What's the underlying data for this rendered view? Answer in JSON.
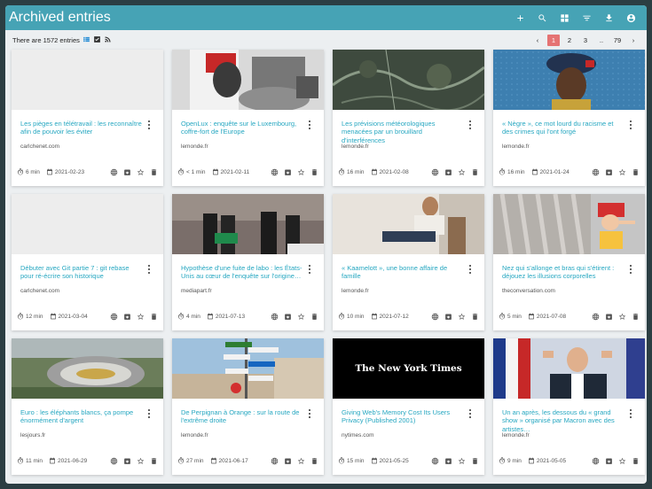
{
  "topbar": {
    "title": "Archived entries",
    "icons": [
      "plus-icon",
      "search-icon",
      "grid-icon",
      "filter-icon",
      "download-icon",
      "account-icon"
    ]
  },
  "subbar": {
    "count_text": "There are 1572 entries",
    "pagination": [
      "‹",
      "1",
      "2",
      "3",
      "..",
      "79",
      "›"
    ],
    "active_page": "1"
  },
  "entries": [
    {
      "title": "Les pièges en télétravail : les reconnaître afin de pouvoir les éviter",
      "domain": "carlchenet.com",
      "reading_time": "6 min",
      "date": "2021-02-23",
      "thumb": "blank"
    },
    {
      "title": "OpenLux : enquête sur le Luxembourg, coffre-fort de l'Europe",
      "domain": "lemonde.fr",
      "reading_time": "< 1 min",
      "date": "2021-02-11",
      "thumb": "collage"
    },
    {
      "title": "Les prévisions météorologiques menacées par un brouillard d'interférences",
      "domain": "lemonde.fr",
      "reading_time": "16 min",
      "date": "2021-02-08",
      "thumb": "satellite"
    },
    {
      "title": "« Nègre », ce mot lourd du racisme et des crimes qui l'ont forgé",
      "domain": "lemonde.fr",
      "reading_time": "16 min",
      "date": "2021-01-24",
      "thumb": "portrait"
    },
    {
      "title": "Débuter avec Git partie 7 : git rebase pour ré-écrire son historique",
      "domain": "carlchenet.com",
      "reading_time": "12 min",
      "date": "2021-03-04",
      "thumb": "blank"
    },
    {
      "title": "Hypothèse d'une fuite de labo : les États-Unis au cœur de l'enquête sur l'origine…",
      "domain": "mediapart.fr",
      "reading_time": "4 min",
      "date": "2021-07-13",
      "thumb": "police"
    },
    {
      "title": "« Kaamelott », une bonne affaire de famille",
      "domain": "lemonde.fr",
      "reading_time": "10 min",
      "date": "2021-07-12",
      "thumb": "man-seated"
    },
    {
      "title": "Nez qui s'allonge et bras qui s'étirent : déjouez les illusions corporelles",
      "domain": "theconversation.com",
      "reading_time": "5 min",
      "date": "2021-07-08",
      "thumb": "pinocchio"
    },
    {
      "title": "Euro : les éléphants blancs, ça pompe énormément d'argent",
      "domain": "lesjours.fr",
      "reading_time": "11 min",
      "date": "2021-06-29",
      "thumb": "stadium"
    },
    {
      "title": "De Perpignan à Orange : sur la route de l'extrême droite",
      "domain": "lemonde.fr",
      "reading_time": "27 min",
      "date": "2021-06-17",
      "thumb": "signposts"
    },
    {
      "title": "Giving Web's Memory Cost Its Users Privacy (Published 2001)",
      "domain": "nytimes.com",
      "reading_time": "15 min",
      "date": "2021-05-25",
      "thumb": "nyt",
      "thumb_text": "The New York Times"
    },
    {
      "title": "Un an après, les dessous du « grand show » organisé par Macron avec des artistes…",
      "domain": "lemonde.fr",
      "reading_time": "9 min",
      "date": "2021-05-05",
      "thumb": "speaker"
    }
  ],
  "card_actions": [
    "globe-icon",
    "archive-icon",
    "star-icon",
    "trash-icon"
  ],
  "colors": {
    "topbar": "#46a3b5",
    "link": "#26a7c1",
    "active_page": "#e57373",
    "background": "#2b3e43"
  }
}
